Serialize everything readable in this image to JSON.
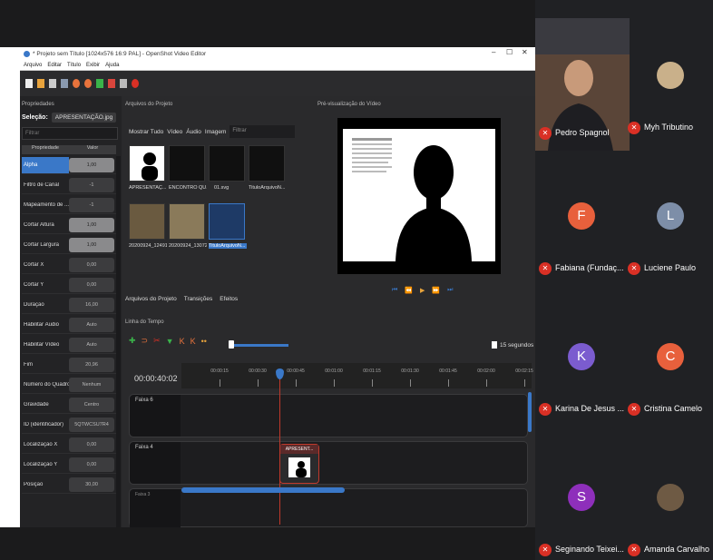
{
  "window": {
    "title": "* Projeto sem Título [1024x576 16:9 PAL] - OpenShot Video Editor",
    "controls": [
      "–",
      "☐",
      "✕"
    ]
  },
  "menu": [
    "Arquivo",
    "Editar",
    "Título",
    "Exibir",
    "Ajuda"
  ],
  "properties": {
    "header": "Propriedades",
    "selection_label": "Seleção:",
    "selection_value": "APRESENTAÇÃO.jpg",
    "filter_placeholder": "Filtrar",
    "col_property": "Propriedade",
    "col_value": "Valor",
    "rows": [
      {
        "name": "Alpha",
        "value": "1,00"
      },
      {
        "name": "Filtro de Canal",
        "value": "-1"
      },
      {
        "name": "Mapeamento de ...",
        "value": "-1"
      },
      {
        "name": "Cortar Altura",
        "value": "1,00"
      },
      {
        "name": "Cortar Largura",
        "value": "1,00"
      },
      {
        "name": "Cortar X",
        "value": "0,00"
      },
      {
        "name": "Cortar Y",
        "value": "0,00"
      },
      {
        "name": "Duração",
        "value": "16,00"
      },
      {
        "name": "Habilitar Áudio",
        "value": "Auto"
      },
      {
        "name": "Habilitar Vídeo",
        "value": "Auto"
      },
      {
        "name": "Fim",
        "value": "20,96"
      },
      {
        "name": "Número do Quadro",
        "value": "Nenhum"
      },
      {
        "name": "Gravidade",
        "value": "Centro"
      },
      {
        "name": "ID (identificador)",
        "value": "5QTWCSU7R4"
      },
      {
        "name": "Localização X",
        "value": "0,00"
      },
      {
        "name": "Localização Y",
        "value": "0,00"
      },
      {
        "name": "Posição",
        "value": "30,00"
      }
    ]
  },
  "files": {
    "header": "Arquivos do Projeto",
    "tabs": [
      "Mostrar Tudo",
      "Vídeo",
      "Áudio",
      "Imagem"
    ],
    "filter_placeholder": "Filtrar",
    "items": [
      {
        "label": "APRESENTAÇ..."
      },
      {
        "label": "ENCONTRO QU..."
      },
      {
        "label": "01.svg"
      },
      {
        "label": "TituloArquivoN..."
      },
      {
        "label": "20200924_12491..."
      },
      {
        "label": "20200924_13072..."
      },
      {
        "label": "TituloArquivoN..."
      }
    ]
  },
  "preview": {
    "header": "Pré-visualização do Vídeo",
    "controls": [
      "⏮",
      "⏪",
      "▶",
      "⏩",
      "⏭"
    ]
  },
  "bottom_tabs": [
    "Arquivos do Projeto",
    "Transições",
    "Efeitos"
  ],
  "timeline": {
    "header": "Linha do Tempo",
    "zoom_label": "15 segundos",
    "timecode": "00:00:40:02",
    "ticks": [
      "00:00:15",
      "00:00:30",
      "00:00:45",
      "00:01:00",
      "00:01:15",
      "00:01:30",
      "00:01:45",
      "00:02:00",
      "00:02:15"
    ],
    "tracks": [
      {
        "name": "Faixa 6"
      },
      {
        "name": "Faixa 4"
      },
      {
        "name": "Faixa 3"
      }
    ],
    "clip_label": "APRESENT..."
  },
  "participants": [
    {
      "name": "Pedro Spagnol",
      "type": "video"
    },
    {
      "name": "Myh Tributino",
      "type": "photo",
      "color": "#c9b08a"
    },
    {
      "name": "Fabiana (Fundaç...",
      "initial": "F",
      "color": "#e8603c"
    },
    {
      "name": "Luciene Paulo",
      "initial": "L",
      "color": "#7d8ea8"
    },
    {
      "name": "Karina De Jesus ...",
      "initial": "K",
      "color": "#7b5ccf"
    },
    {
      "name": "Cristina Camelo",
      "initial": "C",
      "color": "#e8603c"
    },
    {
      "name": "Seginando Teixei...",
      "initial": "S",
      "color": "#8e2fbb"
    },
    {
      "name": "Amanda Carvalho",
      "type": "photo",
      "color": "#6e5a44"
    }
  ]
}
